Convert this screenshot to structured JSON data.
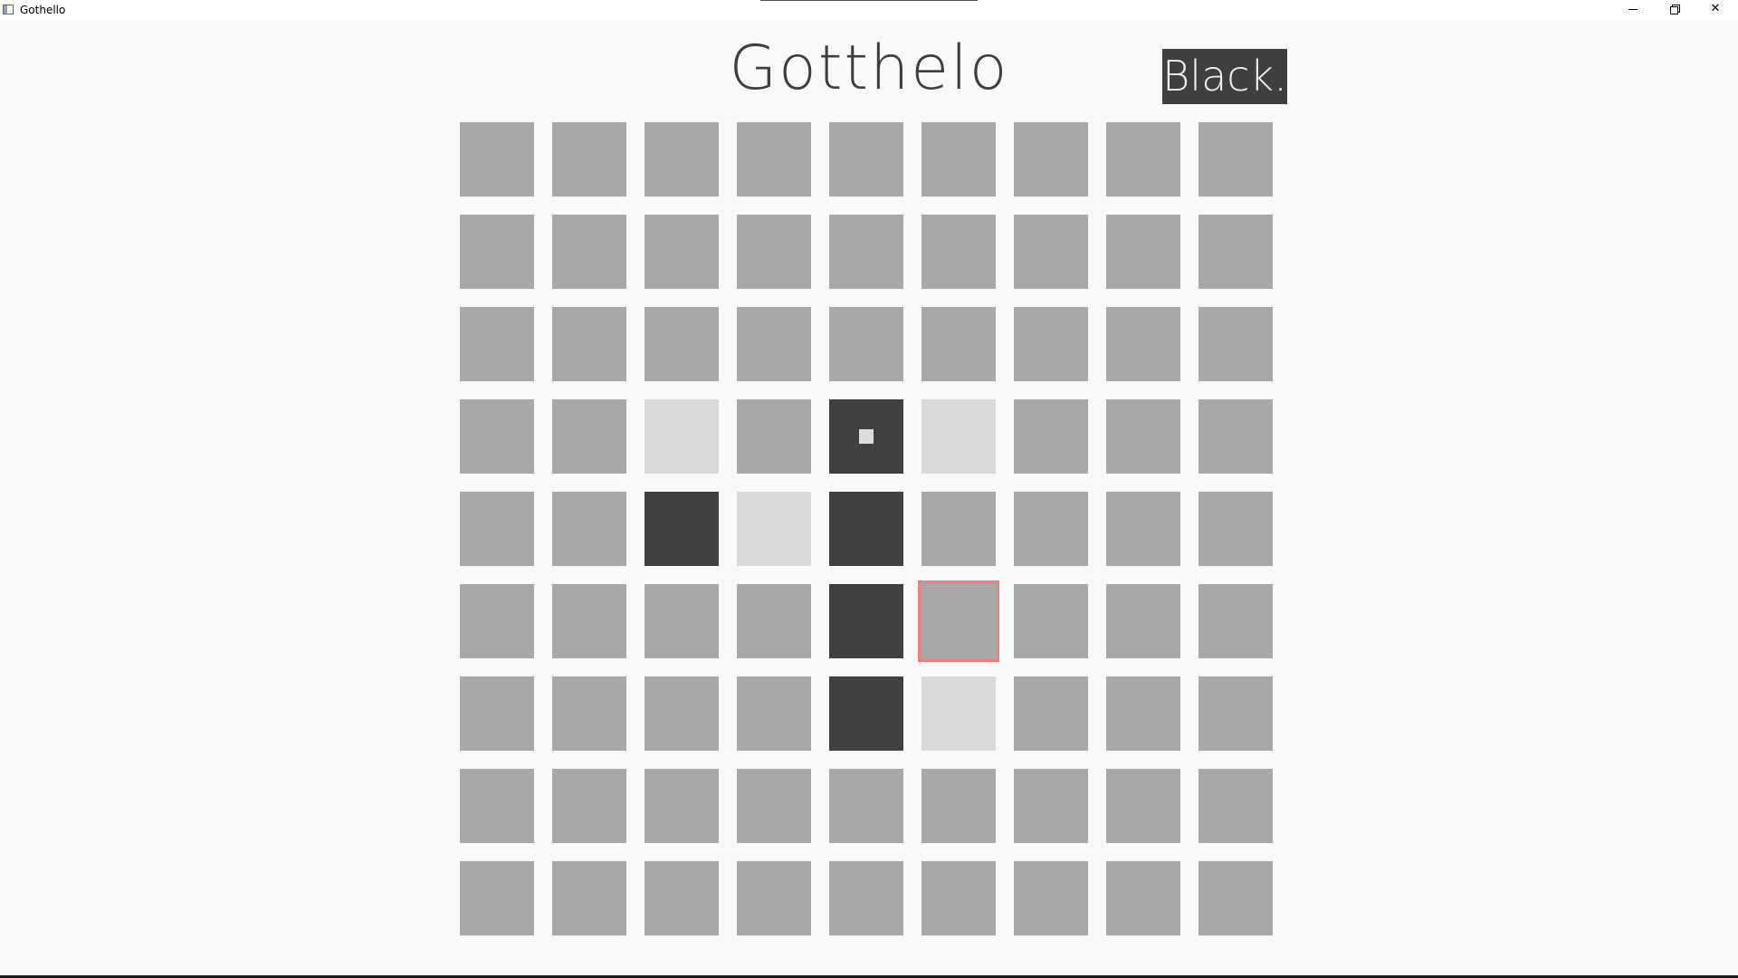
{
  "window": {
    "title": "Gothello"
  },
  "header": {
    "game_title": "Gotthelo",
    "turn_label": "Black."
  },
  "colors": {
    "empty": "#a8a8a8",
    "black": "#404040",
    "white": "#dadada",
    "hover_outline": "#f08080",
    "background": "#f9f9f9"
  },
  "board": {
    "size": 9,
    "rows": [
      [
        "e",
        "e",
        "e",
        "e",
        "e",
        "e",
        "e",
        "e",
        "e"
      ],
      [
        "e",
        "e",
        "e",
        "e",
        "e",
        "e",
        "e",
        "e",
        "e"
      ],
      [
        "e",
        "e",
        "e",
        "e",
        "e",
        "e",
        "e",
        "e",
        "e"
      ],
      [
        "e",
        "e",
        "w",
        "e",
        "b",
        "w",
        "e",
        "e",
        "e"
      ],
      [
        "e",
        "e",
        "b",
        "w",
        "b",
        "e",
        "e",
        "e",
        "e"
      ],
      [
        "e",
        "e",
        "e",
        "e",
        "b",
        "e",
        "e",
        "e",
        "e"
      ],
      [
        "e",
        "e",
        "e",
        "e",
        "b",
        "w",
        "e",
        "e",
        "e"
      ],
      [
        "e",
        "e",
        "e",
        "e",
        "e",
        "e",
        "e",
        "e",
        "e"
      ],
      [
        "e",
        "e",
        "e",
        "e",
        "e",
        "e",
        "e",
        "e",
        "e"
      ]
    ],
    "last_move": {
      "row": 3,
      "col": 4
    },
    "hover": {
      "row": 5,
      "col": 5
    }
  }
}
